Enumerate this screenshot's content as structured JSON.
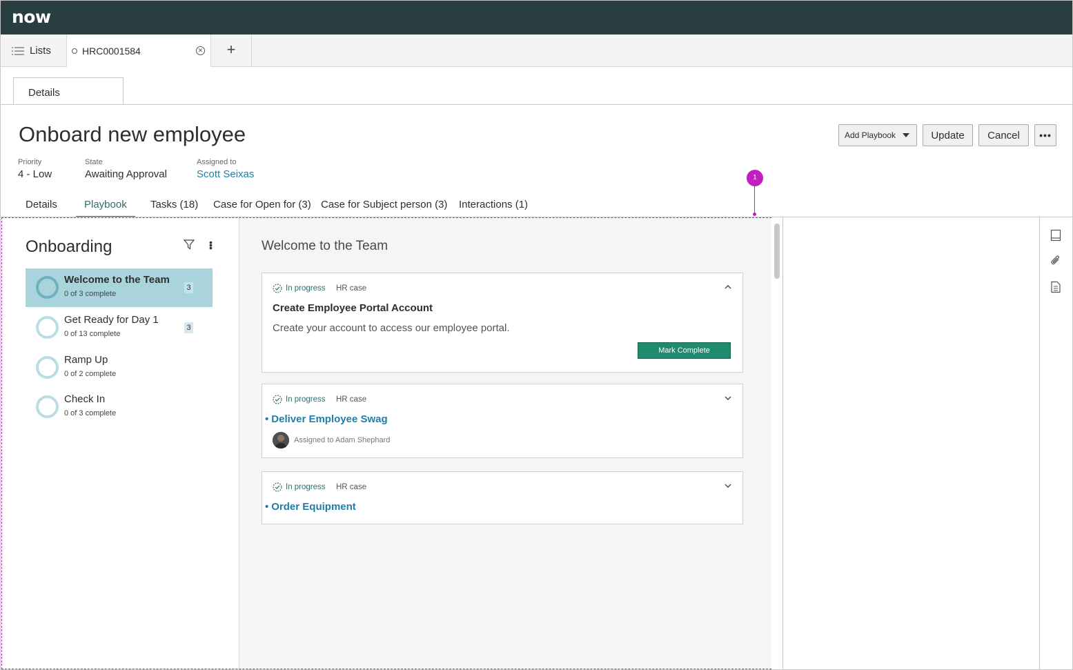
{
  "app": {
    "logo": "now"
  },
  "tabbar": {
    "lists_label": "Lists",
    "record_tab": "HRC0001584",
    "add_tab": "+"
  },
  "detail_tab": "Details",
  "record": {
    "title": "Onboard new employee",
    "priority_label": "Priority",
    "priority_value": "4 - Low",
    "state_label": "State",
    "state_value": "Awaiting Approval",
    "assigned_label": "Assigned to",
    "assigned_value": "Scott Seixas"
  },
  "actions": {
    "add_playbook": "Add Playbook",
    "update": "Update",
    "cancel": "Cancel",
    "more": "•••"
  },
  "annotation_badge": "1",
  "subtabs": [
    {
      "label": "Details"
    },
    {
      "label": "Playbook"
    },
    {
      "label": "Tasks (18)"
    },
    {
      "label": "Case for Open for (3)"
    },
    {
      "label": "Case for Subject person (3)"
    },
    {
      "label": "Interactions (1)"
    }
  ],
  "playbook": {
    "title": "Onboarding",
    "stages": [
      {
        "name": "Welcome to the Team",
        "sub": "0 of 3 complete",
        "count": "3"
      },
      {
        "name": "Get Ready for Day 1",
        "sub": "0 of 13 complete",
        "count": "3"
      },
      {
        "name": "Ramp Up",
        "sub": "0 of 2 complete"
      },
      {
        "name": "Check In",
        "sub": "0 of 3 complete"
      }
    ],
    "stage_title": "Welcome to the Team",
    "cards": [
      {
        "status": "In progress",
        "type": "HR case",
        "title": "Create Employee Portal Account",
        "desc": "Create your account to access our employee portal.",
        "button": "Mark Complete"
      },
      {
        "status": "In progress",
        "type": "HR case",
        "title": "Deliver Employee Swag",
        "assigned": "Assigned to Adam Shephard"
      },
      {
        "status": "In progress",
        "type": "HR case",
        "title": "Order Equipment"
      }
    ]
  },
  "colors": {
    "topbar": "#293e40",
    "accent": "#2e6e6a",
    "link": "#1f7ea8",
    "selected_stage": "#a9d4dc",
    "mark_complete": "#1f8a6e",
    "badge": "#c020c0"
  }
}
